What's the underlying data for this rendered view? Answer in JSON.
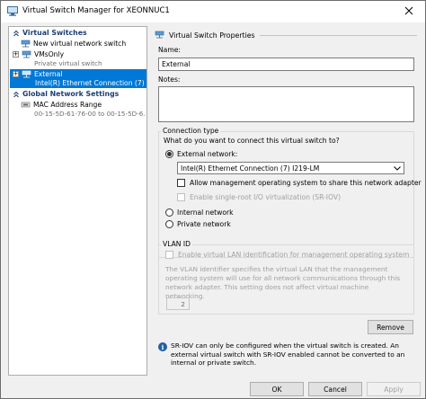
{
  "window": {
    "title": "Virtual Switch Manager for XEONNUC1"
  },
  "tree": {
    "virtual_switches_header": "Virtual Switches",
    "new_switch": "New virtual network switch",
    "switches": [
      {
        "name": "VMsOnly",
        "sub": "Private virtual switch",
        "expander": "+"
      },
      {
        "name": "External",
        "sub": "Intel(R) Ethernet Connection (7) I2...",
        "expander": "+"
      }
    ],
    "global_header": "Global Network Settings",
    "mac_range": {
      "name": "MAC Address Range",
      "sub": "00-15-5D-61-76-00 to 00-15-5D-6..."
    }
  },
  "properties": {
    "header": "Virtual Switch Properties",
    "name_label": "Name:",
    "name_value": "External",
    "notes_label": "Notes:",
    "notes_value": "",
    "connection_type": {
      "title": "Connection type",
      "question": "What do you want to connect this virtual switch to?",
      "external_label": "External network:",
      "adapter_value": "Intel(R) Ethernet Connection (7) I219-LM",
      "allow_mgmt_label": "Allow management operating system to share this network adapter",
      "sriov_label": "Enable single-root I/O virtualization (SR-IOV)",
      "internal_label": "Internal network",
      "private_label": "Private network",
      "selected": "external"
    },
    "vlan": {
      "title": "VLAN ID",
      "enable_label": "Enable virtual LAN identification for management operating system",
      "description": "The VLAN identifier specifies the virtual LAN that the management operating system will use for all network communications through this network adapter. This setting does not affect virtual machine networking.",
      "value": "2"
    },
    "remove_label": "Remove",
    "info_text": "SR-IOV can only be configured when the virtual switch is created. An external virtual switch with SR-IOV enabled cannot be converted to an internal or private switch."
  },
  "buttons": {
    "ok": "OK",
    "cancel": "Cancel",
    "apply": "Apply"
  },
  "colors": {
    "selection": "#0078d7",
    "header_text": "#1c3f73",
    "disabled_text": "#a0a0a0"
  }
}
